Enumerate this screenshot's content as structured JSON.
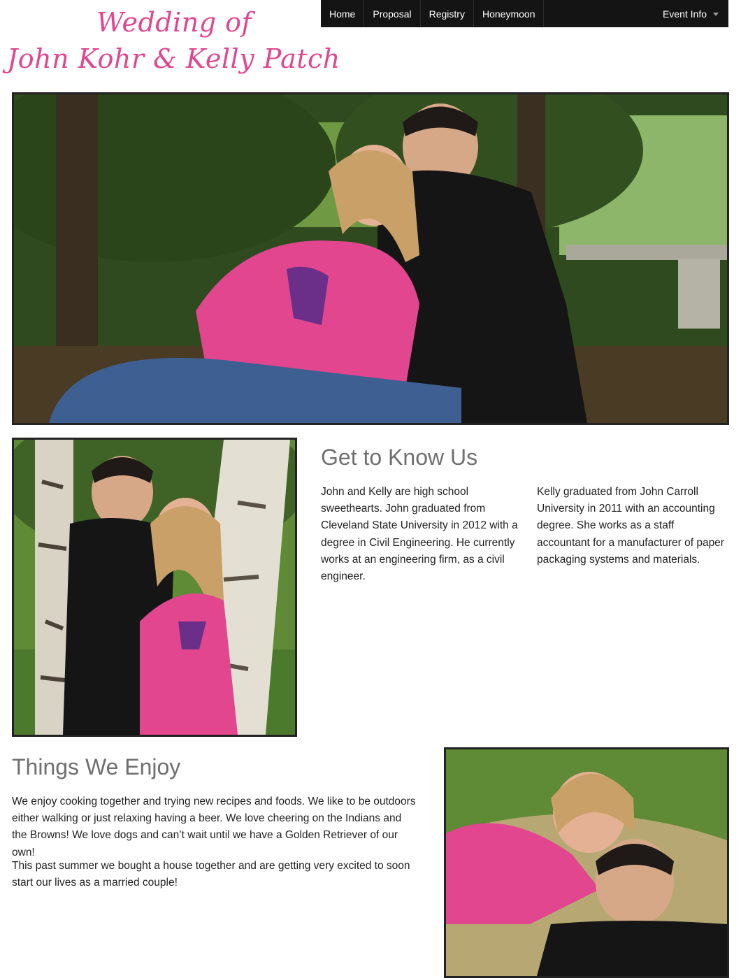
{
  "logo": {
    "line1": "Wedding of",
    "line2": "John Kohr & Kelly Patch",
    "color": "#e1468f"
  },
  "nav": {
    "items": [
      "Home",
      "Proposal",
      "Registry",
      "Honeymoon"
    ],
    "event_info": "Event Info",
    "background": "#141414"
  },
  "know": {
    "title": "Get to Know Us",
    "col1": "John and Kelly are high school sweethearts. John graduated from Cleveland State University in 2012 with a degree in Civil Engineering. He currently works at an engineering firm, as a civil engineer.",
    "col2": "Kelly graduated from John Carroll University in 2011 with an accounting degree. She works as a staff accountant for a manufacturer of paper packaging systems and materials."
  },
  "enjoy": {
    "title": "Things We Enjoy",
    "p1": "We enjoy cooking together and trying new recipes and foods. We like to be outdoors either walking or just relaxing having a beer. We love cheering on the Indians and the Browns! We love dogs and can’t wait until we have a Golden Retriever of our own!",
    "p2": "This past summer we bought a house together and are getting very excited to soon start our lives as a married couple!"
  },
  "colors": {
    "heading": "#6f6f6f",
    "pink_cardigan": "#e1468f",
    "photo_border": "#222222"
  }
}
